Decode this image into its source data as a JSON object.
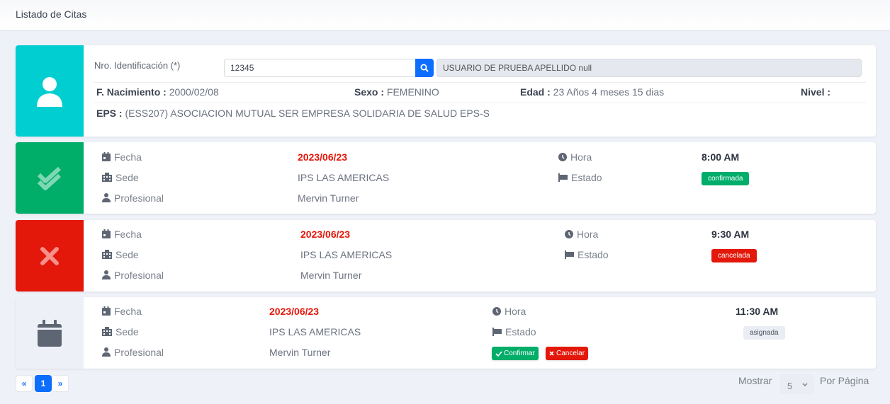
{
  "header": {
    "title": "Listado de Citas"
  },
  "patient": {
    "id_label": "Nro. Identificación (*)",
    "id_value": "12345",
    "name_value": "USUARIO DE PRUEBA APELLIDO null",
    "birth_label": "F. Nacimiento :",
    "birth_value": "2000/02/08",
    "sex_label": "Sexo :",
    "sex_value": "FEMENINO",
    "age_label": "Edad :",
    "age_value": "23 Años 4 meses 15 dias",
    "level_label": "Nivel :",
    "level_value": "",
    "eps_label": "EPS :",
    "eps_value": "(ESS207) ASOCIACION MUTUAL SER EMPRESA SOLIDARIA DE SALUD EPS-S",
    "color": "#00ced1"
  },
  "labels": {
    "fecha": "Fecha",
    "sede": "Sede",
    "profesional": "Profesional",
    "hora": "Hora",
    "estado": "Estado"
  },
  "appointments": [
    {
      "status_icon": "double-check-icon",
      "color": "#00ad69",
      "fecha": "2023/06/23",
      "sede": "IPS LAS AMERICAS",
      "profesional": "Mervin Turner",
      "hora": "8:00 AM",
      "estado": "confirmada",
      "estado_color": "#00ad69"
    },
    {
      "status_icon": "x-icon",
      "color": "#e3170a",
      "fecha": "2023/06/23",
      "sede": "IPS LAS AMERICAS",
      "profesional": "Mervin Turner",
      "hora": "9:30 AM",
      "estado": "cancelada",
      "estado_color": "#e3170a"
    },
    {
      "status_icon": "calendar-icon",
      "color": "#edf0f7",
      "fecha": "2023/06/23",
      "sede": "IPS LAS AMERICAS",
      "profesional": "Mervin Turner",
      "hora": "11:30 AM",
      "estado": "asignada",
      "estado_color": "#eaedf3",
      "actions": {
        "confirm": "Confirmar",
        "cancel": "Cancelar"
      }
    }
  ],
  "pagination": {
    "prev": "«",
    "current": "1",
    "next": "»",
    "show_label": "Mostrar",
    "per_page": "5",
    "per_page_label": "Por Página"
  }
}
